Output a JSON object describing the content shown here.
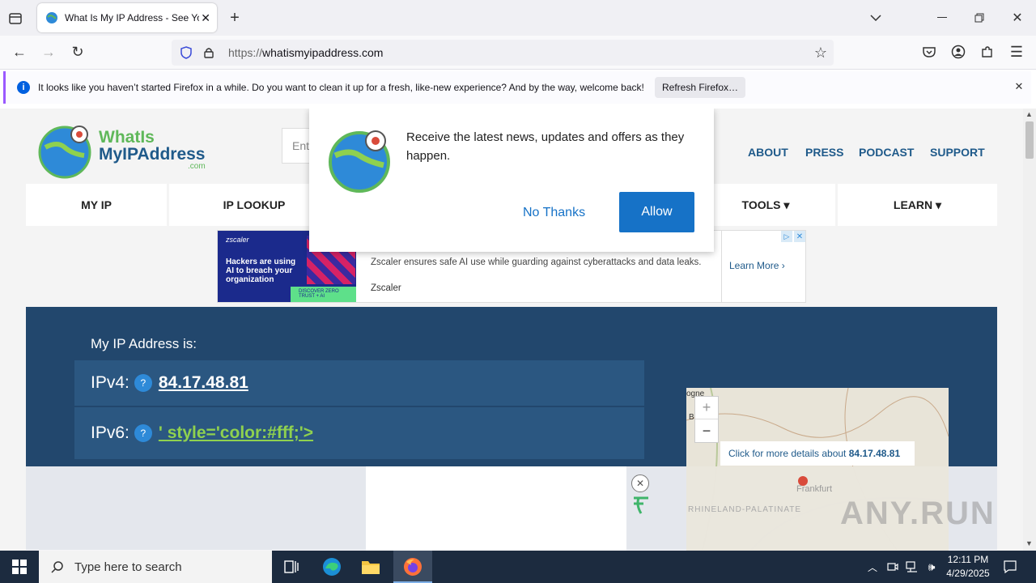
{
  "browser": {
    "tab_title": "What Is My IP Address - See Your",
    "url_prefix": "https://",
    "url_domain": "whatismyipaddress.com",
    "notification_text": "It looks like you haven’t started Firefox in a while. Do you want to clean it up for a fresh, like-new experience? And by the way, welcome back!",
    "refresh_button": "Refresh Firefox…"
  },
  "site": {
    "logo_line1": "WhatIs",
    "logo_line2": "MyIPAddress",
    "logo_com": ".com",
    "search_placeholder": "Ent",
    "top_nav": [
      "ABOUT",
      "PRESS",
      "PODCAST",
      "SUPPORT"
    ],
    "menu": [
      "MY IP",
      "IP LOOKUP",
      "",
      "",
      "TOOLS ▾",
      "LEARN ▾"
    ],
    "ip_heading": "My IP Address is:",
    "ipv4_label": "IPv4:",
    "ipv4_value": "84.17.48.81",
    "ipv6_label": "IPv6:",
    "ipv6_value": "' style='color:#fff;'>",
    "qmark": "?",
    "map_link_text": "Click for more details about",
    "map_link_ip": "84.17.48.81",
    "map_label_frankfurt": "Frankfurt",
    "map_label_region": "RHINELAND-PALATINATE",
    "map_label_corner": "ogne",
    "map_label_b": "B"
  },
  "popup": {
    "message": "Receive the latest news, updates and offers as they happen.",
    "no_thanks": "No Thanks",
    "allow": "Allow"
  },
  "ad": {
    "brand_tag": "zscaler",
    "image_text": "Hackers are using AI to breach your organization",
    "image_sub": "DISCOVER ZERO TRUST + AI",
    "body": "Zscaler ensures safe AI use while guarding against cyberattacks and data leaks.",
    "advertiser": "Zscaler",
    "cta": "Learn More"
  },
  "taskbar": {
    "search_placeholder": "Type here to search",
    "time": "12:11 PM",
    "date": "4/29/2025"
  },
  "watermark": "ANY.RUN",
  "colors": {
    "blue_box": "#22476d",
    "ip_row": "#2b5781",
    "allow": "#1672c7",
    "ipv6_green": "#8fd14f"
  }
}
